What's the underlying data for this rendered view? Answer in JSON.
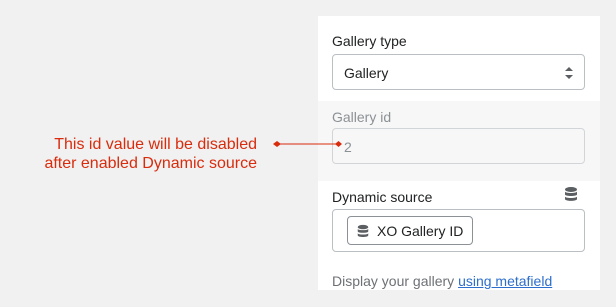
{
  "gallery_type": {
    "label": "Gallery type",
    "selected": "Gallery"
  },
  "gallery_id": {
    "label": "Gallery id",
    "value": "2",
    "disabled": true
  },
  "dynamic_source": {
    "label": "Dynamic source",
    "tag_label": "XO Gallery ID",
    "help_text": "Display your gallery ",
    "help_link": "using metafield",
    "icon": "database-icon"
  },
  "annotation": {
    "line1": "This id value will be disabled",
    "line2": "after enabled Dynamic source",
    "color": "#d82c0d"
  },
  "colors": {
    "link": "#2c6ecb",
    "panel_bg": "#ffffff",
    "page_bg": "#f1f1f1"
  }
}
